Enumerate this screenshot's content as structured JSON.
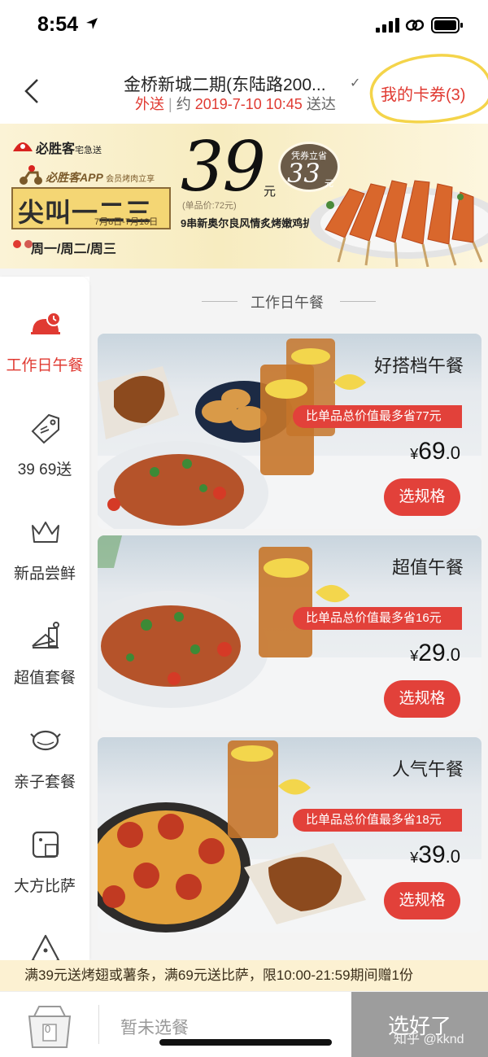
{
  "status_bar": {
    "time": "8:54"
  },
  "header": {
    "store_name": "金桥新城二期(东陆路200...",
    "mode": "外送",
    "eta_prefix": "约",
    "eta_time": "2019-7-10 10:45",
    "eta_suffix": "送达",
    "my_coupons": "我的卡券(3)"
  },
  "banner": {
    "brand": "必胜客",
    "brand_sub": "宅急送",
    "app_promo": "必胜客APP",
    "app_promo_sub": "会员烤肉立享",
    "event_title": "尖叫一二三",
    "event_dates": "7月8日-7月10日",
    "week_text": "周一/周二/周三",
    "price": "39",
    "price_unit": "元",
    "badge_label": "凭券立省",
    "badge_value": "33",
    "badge_unit": "元",
    "single_price": "(单品价:72元)",
    "product": "9串新奥尔良风情炙烤嫩鸡扒"
  },
  "sidebar": {
    "items": [
      {
        "label": "工作日午餐",
        "icon": "lunch-bell-icon",
        "active": true
      },
      {
        "label": "39 69送",
        "icon": "price-tag-icon",
        "active": false
      },
      {
        "label": "新品尝鲜",
        "icon": "crown-icon",
        "active": false
      },
      {
        "label": "超值套餐",
        "icon": "meal-set-icon",
        "active": false
      },
      {
        "label": "亲子套餐",
        "icon": "pot-icon",
        "active": false
      },
      {
        "label": "大方比萨",
        "icon": "square-pizza-icon",
        "active": false
      },
      {
        "label": "",
        "icon": "pizza-slice-icon",
        "active": false
      }
    ]
  },
  "section": {
    "title": "工作日午餐"
  },
  "cards": [
    {
      "title": "好搭档午餐",
      "saving": "比单品总价值最多省77元",
      "currency": "¥",
      "price_int": "69",
      "price_dec": ".0",
      "button": "选规格"
    },
    {
      "title": "超值午餐",
      "saving": "比单品总价值最多省16元",
      "currency": "¥",
      "price_int": "29",
      "price_dec": ".0",
      "button": "选规格"
    },
    {
      "title": "人气午餐",
      "saving": "比单品总价值最多省18元",
      "currency": "¥",
      "price_int": "39",
      "price_dec": ".0",
      "button": "选规格"
    }
  ],
  "promo_bar": {
    "text": "满39元送烤翅或薯条，满69元送比萨，限10:00-21:59期间赠1份"
  },
  "bottom_bar": {
    "cart_count": "0",
    "no_selection": "暂未选餐",
    "done": "选好了",
    "watermark": "知乎 @kknd"
  },
  "colors": {
    "accent": "#e2413a",
    "done_button": "#9d9d9d",
    "promo_bg": "#fcf1d2"
  }
}
